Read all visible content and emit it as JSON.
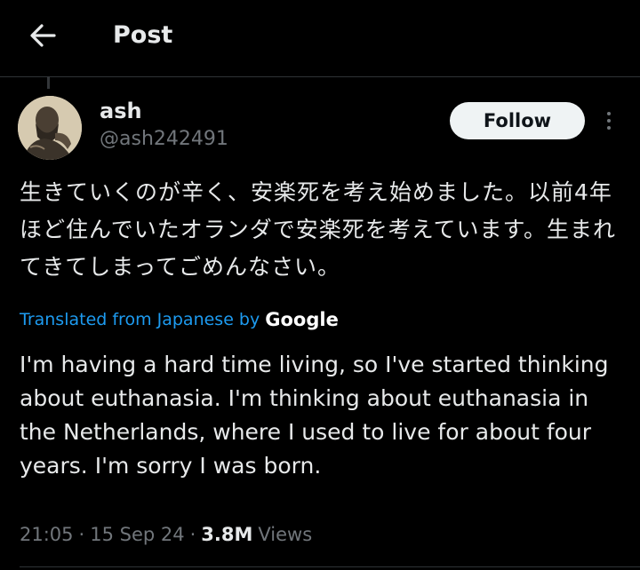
{
  "header": {
    "title": "Post",
    "back_icon": "arrow-left-icon"
  },
  "author": {
    "display_name": "ash",
    "handle": "@ash242491",
    "avatar_icon": "avatar-image"
  },
  "actions": {
    "follow_label": "Follow",
    "more_icon": "more-vertical-icon"
  },
  "post": {
    "original_text": "生きていくのが辛く、安楽死を考え始めました。以前4年ほど住んでいたオランダで安楽死を考えています。生まれてきてしまってごめんなさい。",
    "translated_label": "Translated from Japanese by",
    "translation_provider": "Google",
    "translated_text": "I'm having a hard time living, so I've started thinking about euthanasia. I'm thinking about euthanasia in the Netherlands, where I used to live for about four years. I'm sorry I was born."
  },
  "meta": {
    "time": "21:05",
    "separator": "·",
    "date": "15 Sep 24",
    "views_count": "3.8M",
    "views_label": "Views"
  },
  "colors": {
    "background": "#000000",
    "text_primary": "#e7e9ea",
    "text_secondary": "#71767b",
    "link": "#1d9bf0",
    "follow_button_bg": "#eff3f4",
    "follow_button_text": "#0f1419",
    "divider": "#2f3336"
  }
}
